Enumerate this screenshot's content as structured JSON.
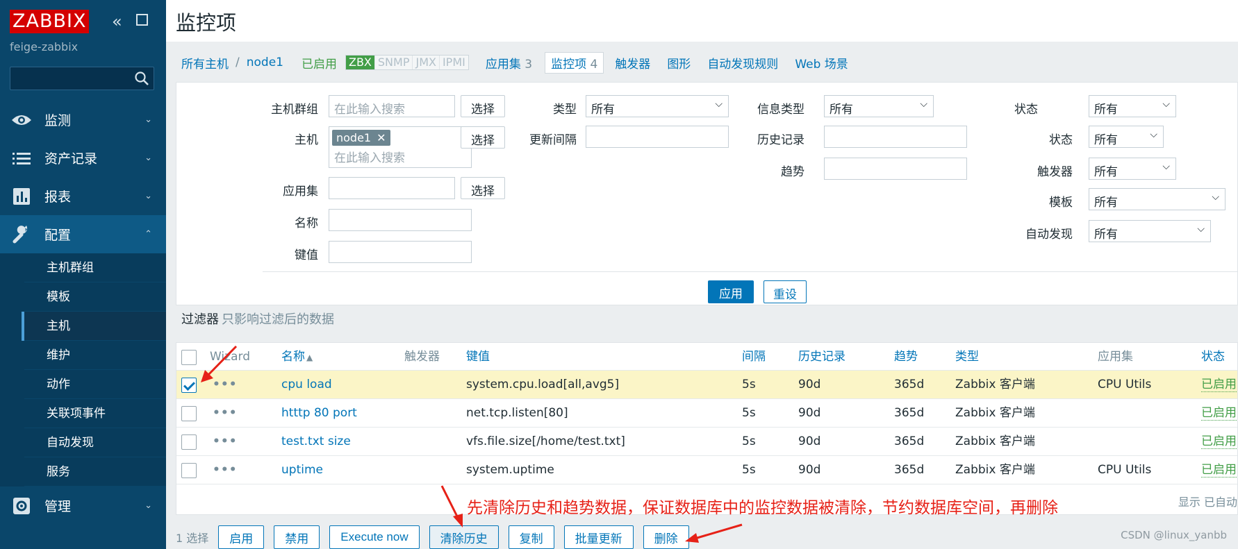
{
  "sidebar": {
    "logo": "ZABBIX",
    "server_name": "feige-zabbix",
    "menu": [
      {
        "label": "监测",
        "icon": "eye-icon"
      },
      {
        "label": "资产记录",
        "icon": "list-icon"
      },
      {
        "label": "报表",
        "icon": "bar-chart-icon"
      },
      {
        "label": "配置",
        "icon": "wrench-icon"
      },
      {
        "label": "管理",
        "icon": "gear-icon"
      }
    ],
    "submenu": [
      "主机群组",
      "模板",
      "主机",
      "维护",
      "动作",
      "关联项事件",
      "自动发现",
      "服务"
    ],
    "active_sub": "主机"
  },
  "page": {
    "title": "监控项"
  },
  "host_nav": {
    "all_hosts": "所有主机",
    "separator": "/",
    "host": "node1",
    "status": "已启用",
    "availability": [
      "ZBX",
      "SNMP",
      "JMX",
      "IPMI"
    ],
    "tabs": [
      {
        "label": "应用集",
        "count": "3"
      },
      {
        "label": "监控项",
        "count": "4"
      },
      {
        "label": "触发器",
        "count": ""
      },
      {
        "label": "图形",
        "count": ""
      },
      {
        "label": "自动发现规则",
        "count": ""
      },
      {
        "label": "Web 场景",
        "count": ""
      }
    ]
  },
  "filter": {
    "host_group_label": "主机群组",
    "host_label": "主机",
    "application_label": "应用集",
    "name_label": "名称",
    "key_label": "键值",
    "search_placeholder": "在此输入搜索",
    "select_button": "选择",
    "host_tag": "node1",
    "type_label": "类型",
    "interval_label": "更新间隔",
    "info_type_label": "信息类型",
    "history_label": "历史记录",
    "trends_label": "趋势",
    "state_label": "状态",
    "status_label": "状态",
    "triggers_label": "触发器",
    "template_label": "模板",
    "discovery_label": "自动发现",
    "all_value": "所有",
    "apply_button": "应用",
    "reset_button": "重设",
    "caption": "过滤器",
    "caption_hint": "只影响过滤后的数据"
  },
  "table": {
    "headers": {
      "wizard": "Wizard",
      "name": "名称",
      "sort_arrow": "▲",
      "triggers": "触发器",
      "key": "键值",
      "interval": "间隔",
      "history": "历史记录",
      "trends": "趋势",
      "type": "类型",
      "applications": "应用集",
      "status": "状态"
    },
    "dots": "•••",
    "rows": [
      {
        "name": "cpu load",
        "key": "system.cpu.load[all,avg5]",
        "interval": "5s",
        "history": "90d",
        "trends": "365d",
        "type": "Zabbix 客户端",
        "application": "CPU Utils",
        "status": "已启用",
        "checked": true
      },
      {
        "name": "htttp 80 port",
        "key": "net.tcp.listen[80]",
        "interval": "5s",
        "history": "90d",
        "trends": "365d",
        "type": "Zabbix 客户端",
        "application": "",
        "status": "已启用",
        "checked": false
      },
      {
        "name": "test.txt size",
        "key": "vfs.file.size[/home/test.txt]",
        "interval": "5s",
        "history": "90d",
        "trends": "365d",
        "type": "Zabbix 客户端",
        "application": "",
        "status": "已启用",
        "checked": false
      },
      {
        "name": "uptime",
        "key": "system.uptime",
        "interval": "5s",
        "history": "90d",
        "trends": "365d",
        "type": "Zabbix 客户端",
        "application": "CPU Utils",
        "status": "已启用",
        "checked": false
      }
    ],
    "shown_text": "显示 已自动"
  },
  "actions": {
    "selected_count": "1 选择",
    "buttons": [
      "启用",
      "禁用",
      "Execute now",
      "清除历史",
      "复制",
      "批量更新",
      "删除"
    ]
  },
  "annotation": "先清除历史和趋势数据，保证数据库中的监控数据被清除，节约数据库空间，再删除",
  "watermark": "CSDN @linux_yanbb",
  "colors": {
    "sidebar": "#0a466a",
    "link": "#0275b8",
    "enabled": "#429e47",
    "annotation": "#e62117",
    "selected_row": "#fbf5c7"
  }
}
